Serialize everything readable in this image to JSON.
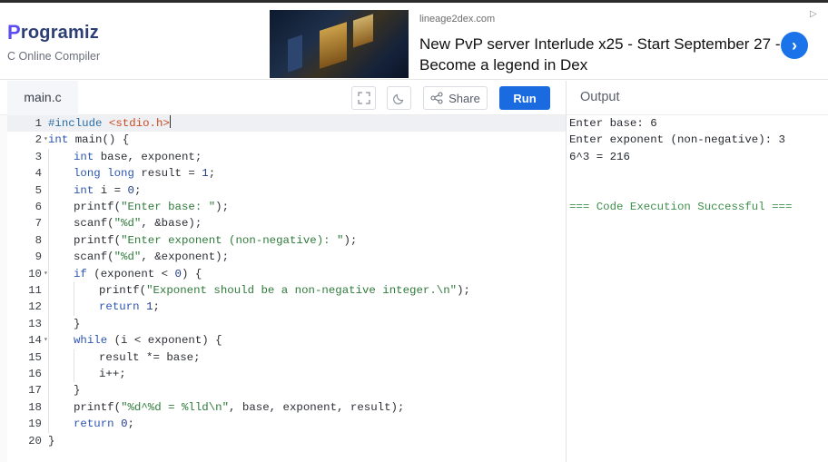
{
  "brand": {
    "name": "rogramiz",
    "logo_letter": "P",
    "subtitle": "C Online Compiler"
  },
  "ad": {
    "domain": "lineage2dex.com",
    "title": "New PvP server Interlude x25 - Start September 27 - Become a legend in Dex",
    "go_icon": "›",
    "choices_icon": "▷"
  },
  "editor": {
    "file_name": "main.c",
    "share_label": "Share",
    "run_label": "Run",
    "code_lines": [
      {
        "n": "1",
        "fold": false,
        "indent": 0,
        "active": true,
        "tokens": [
          [
            "pre",
            "#include "
          ],
          [
            "inc",
            "<stdio.h>"
          ]
        ]
      },
      {
        "n": "2",
        "fold": true,
        "indent": 0,
        "active": false,
        "tokens": [
          [
            "kw",
            "int"
          ],
          [
            "plain",
            " main() {"
          ]
        ]
      },
      {
        "n": "3",
        "fold": false,
        "indent": 1,
        "active": false,
        "tokens": [
          [
            "kw",
            "int"
          ],
          [
            "plain",
            " base, exponent;"
          ]
        ]
      },
      {
        "n": "4",
        "fold": false,
        "indent": 1,
        "active": false,
        "tokens": [
          [
            "kw",
            "long long"
          ],
          [
            "plain",
            " result = "
          ],
          [
            "num",
            "1"
          ],
          [
            "plain",
            ";"
          ]
        ]
      },
      {
        "n": "5",
        "fold": false,
        "indent": 1,
        "active": false,
        "tokens": [
          [
            "kw",
            "int"
          ],
          [
            "plain",
            " i = "
          ],
          [
            "num",
            "0"
          ],
          [
            "plain",
            ";"
          ]
        ]
      },
      {
        "n": "6",
        "fold": false,
        "indent": 1,
        "active": false,
        "tokens": [
          [
            "plain",
            "printf("
          ],
          [
            "str",
            "\"Enter base: \""
          ],
          [
            "plain",
            ");"
          ]
        ]
      },
      {
        "n": "7",
        "fold": false,
        "indent": 1,
        "active": false,
        "tokens": [
          [
            "plain",
            "scanf("
          ],
          [
            "str",
            "\"%d\""
          ],
          [
            "plain",
            ", &base);"
          ]
        ]
      },
      {
        "n": "8",
        "fold": false,
        "indent": 1,
        "active": false,
        "tokens": [
          [
            "plain",
            "printf("
          ],
          [
            "str",
            "\"Enter exponent (non-negative): \""
          ],
          [
            "plain",
            ");"
          ]
        ]
      },
      {
        "n": "9",
        "fold": false,
        "indent": 1,
        "active": false,
        "tokens": [
          [
            "plain",
            "scanf("
          ],
          [
            "str",
            "\"%d\""
          ],
          [
            "plain",
            ", &exponent);"
          ]
        ]
      },
      {
        "n": "10",
        "fold": true,
        "indent": 1,
        "active": false,
        "tokens": [
          [
            "kw",
            "if"
          ],
          [
            "plain",
            " (exponent < "
          ],
          [
            "num",
            "0"
          ],
          [
            "plain",
            ") {"
          ]
        ]
      },
      {
        "n": "11",
        "fold": false,
        "indent": 2,
        "active": false,
        "tokens": [
          [
            "plain",
            "printf("
          ],
          [
            "str",
            "\"Exponent should be a non-negative integer.\\n\""
          ],
          [
            "plain",
            ");"
          ]
        ]
      },
      {
        "n": "12",
        "fold": false,
        "indent": 2,
        "active": false,
        "tokens": [
          [
            "kw",
            "return"
          ],
          [
            "plain",
            " "
          ],
          [
            "num",
            "1"
          ],
          [
            "plain",
            ";"
          ]
        ]
      },
      {
        "n": "13",
        "fold": false,
        "indent": 1,
        "active": false,
        "tokens": [
          [
            "plain",
            "}"
          ]
        ]
      },
      {
        "n": "14",
        "fold": true,
        "indent": 1,
        "active": false,
        "tokens": [
          [
            "kw",
            "while"
          ],
          [
            "plain",
            " (i < exponent) {"
          ]
        ]
      },
      {
        "n": "15",
        "fold": false,
        "indent": 2,
        "active": false,
        "tokens": [
          [
            "plain",
            "result *= base;"
          ]
        ]
      },
      {
        "n": "16",
        "fold": false,
        "indent": 2,
        "active": false,
        "tokens": [
          [
            "plain",
            "i++;"
          ]
        ]
      },
      {
        "n": "17",
        "fold": false,
        "indent": 1,
        "active": false,
        "tokens": [
          [
            "plain",
            "}"
          ]
        ]
      },
      {
        "n": "18",
        "fold": false,
        "indent": 1,
        "active": false,
        "tokens": [
          [
            "plain",
            "printf("
          ],
          [
            "str",
            "\"%d^%d = %lld\\n\""
          ],
          [
            "plain",
            ", base, exponent, result);"
          ]
        ]
      },
      {
        "n": "19",
        "fold": false,
        "indent": 1,
        "active": false,
        "tokens": [
          [
            "kw",
            "return"
          ],
          [
            "plain",
            " "
          ],
          [
            "num",
            "0"
          ],
          [
            "plain",
            ";"
          ]
        ]
      },
      {
        "n": "20",
        "fold": false,
        "indent": 0,
        "active": false,
        "tokens": [
          [
            "plain",
            "}"
          ]
        ]
      }
    ]
  },
  "output": {
    "title": "Output",
    "lines": [
      "Enter base: 6",
      "Enter exponent (non-negative): 3",
      "6^3 = 216"
    ],
    "success_message": "=== Code Execution Successful ==="
  },
  "colors": {
    "run_button": "#1a6be0",
    "brand": "#2c3e73",
    "success": "#3f8f4c"
  }
}
